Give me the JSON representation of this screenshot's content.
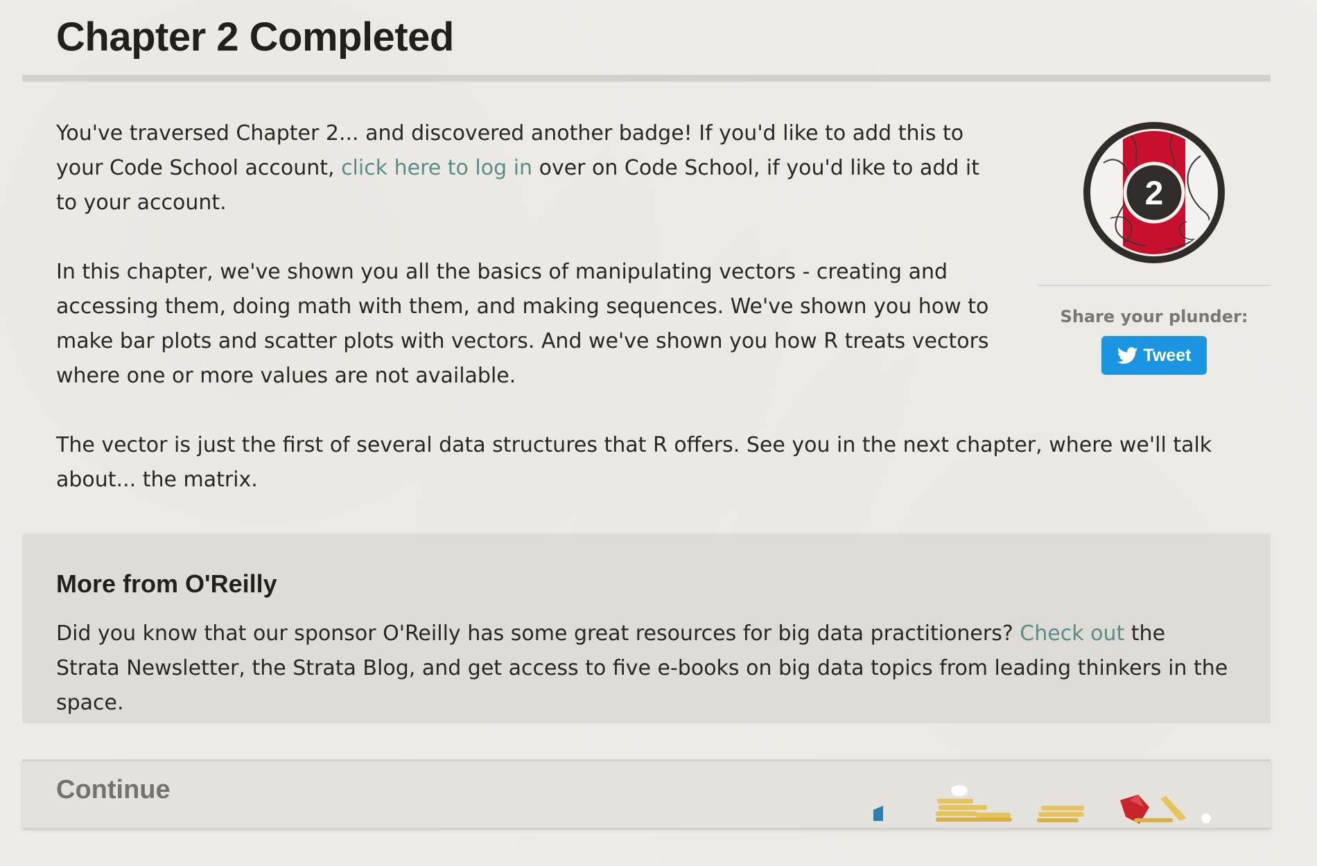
{
  "title": "Chapter 2 Completed",
  "intro": {
    "p1_before": "You've traversed Chapter 2... and discovered another badge! If you'd like to add this to your Code School account, ",
    "p1_link": "click here to log in",
    "p1_after": " over on Code School, if you'd like to add it to your account.",
    "p2": "In this chapter, we've shown you all the basics of manipulating vectors - creating and accessing them, doing math with them, and making sequences. We've shown you how to make bar plots and scatter plots with vectors. And we've shown you how R treats vectors where one or more values are not available.",
    "p3": "The vector is just the first of several data structures that R offers. See you in the next chapter, where we'll talk about... the matrix."
  },
  "badge": {
    "number": "2",
    "accent": "#c8102e",
    "ring": "#2f2c29"
  },
  "share": {
    "label": "Share your plunder:",
    "tweet_label": "Tweet",
    "tweet_color": "#1b95e0"
  },
  "more": {
    "heading": "More from O'Reilly",
    "text_before": "Did you know that our sponsor O'Reilly has some great resources for big data practitioners? ",
    "link": "Check out",
    "text_after": " the Strata Newsletter, the Strata Blog, and get access to five e-books on big data topics from leading thinkers in the space."
  },
  "continue": {
    "label": "Continue"
  },
  "colors": {
    "link": "#5a8c86",
    "text": "#2a2622",
    "background": "#efede8"
  }
}
